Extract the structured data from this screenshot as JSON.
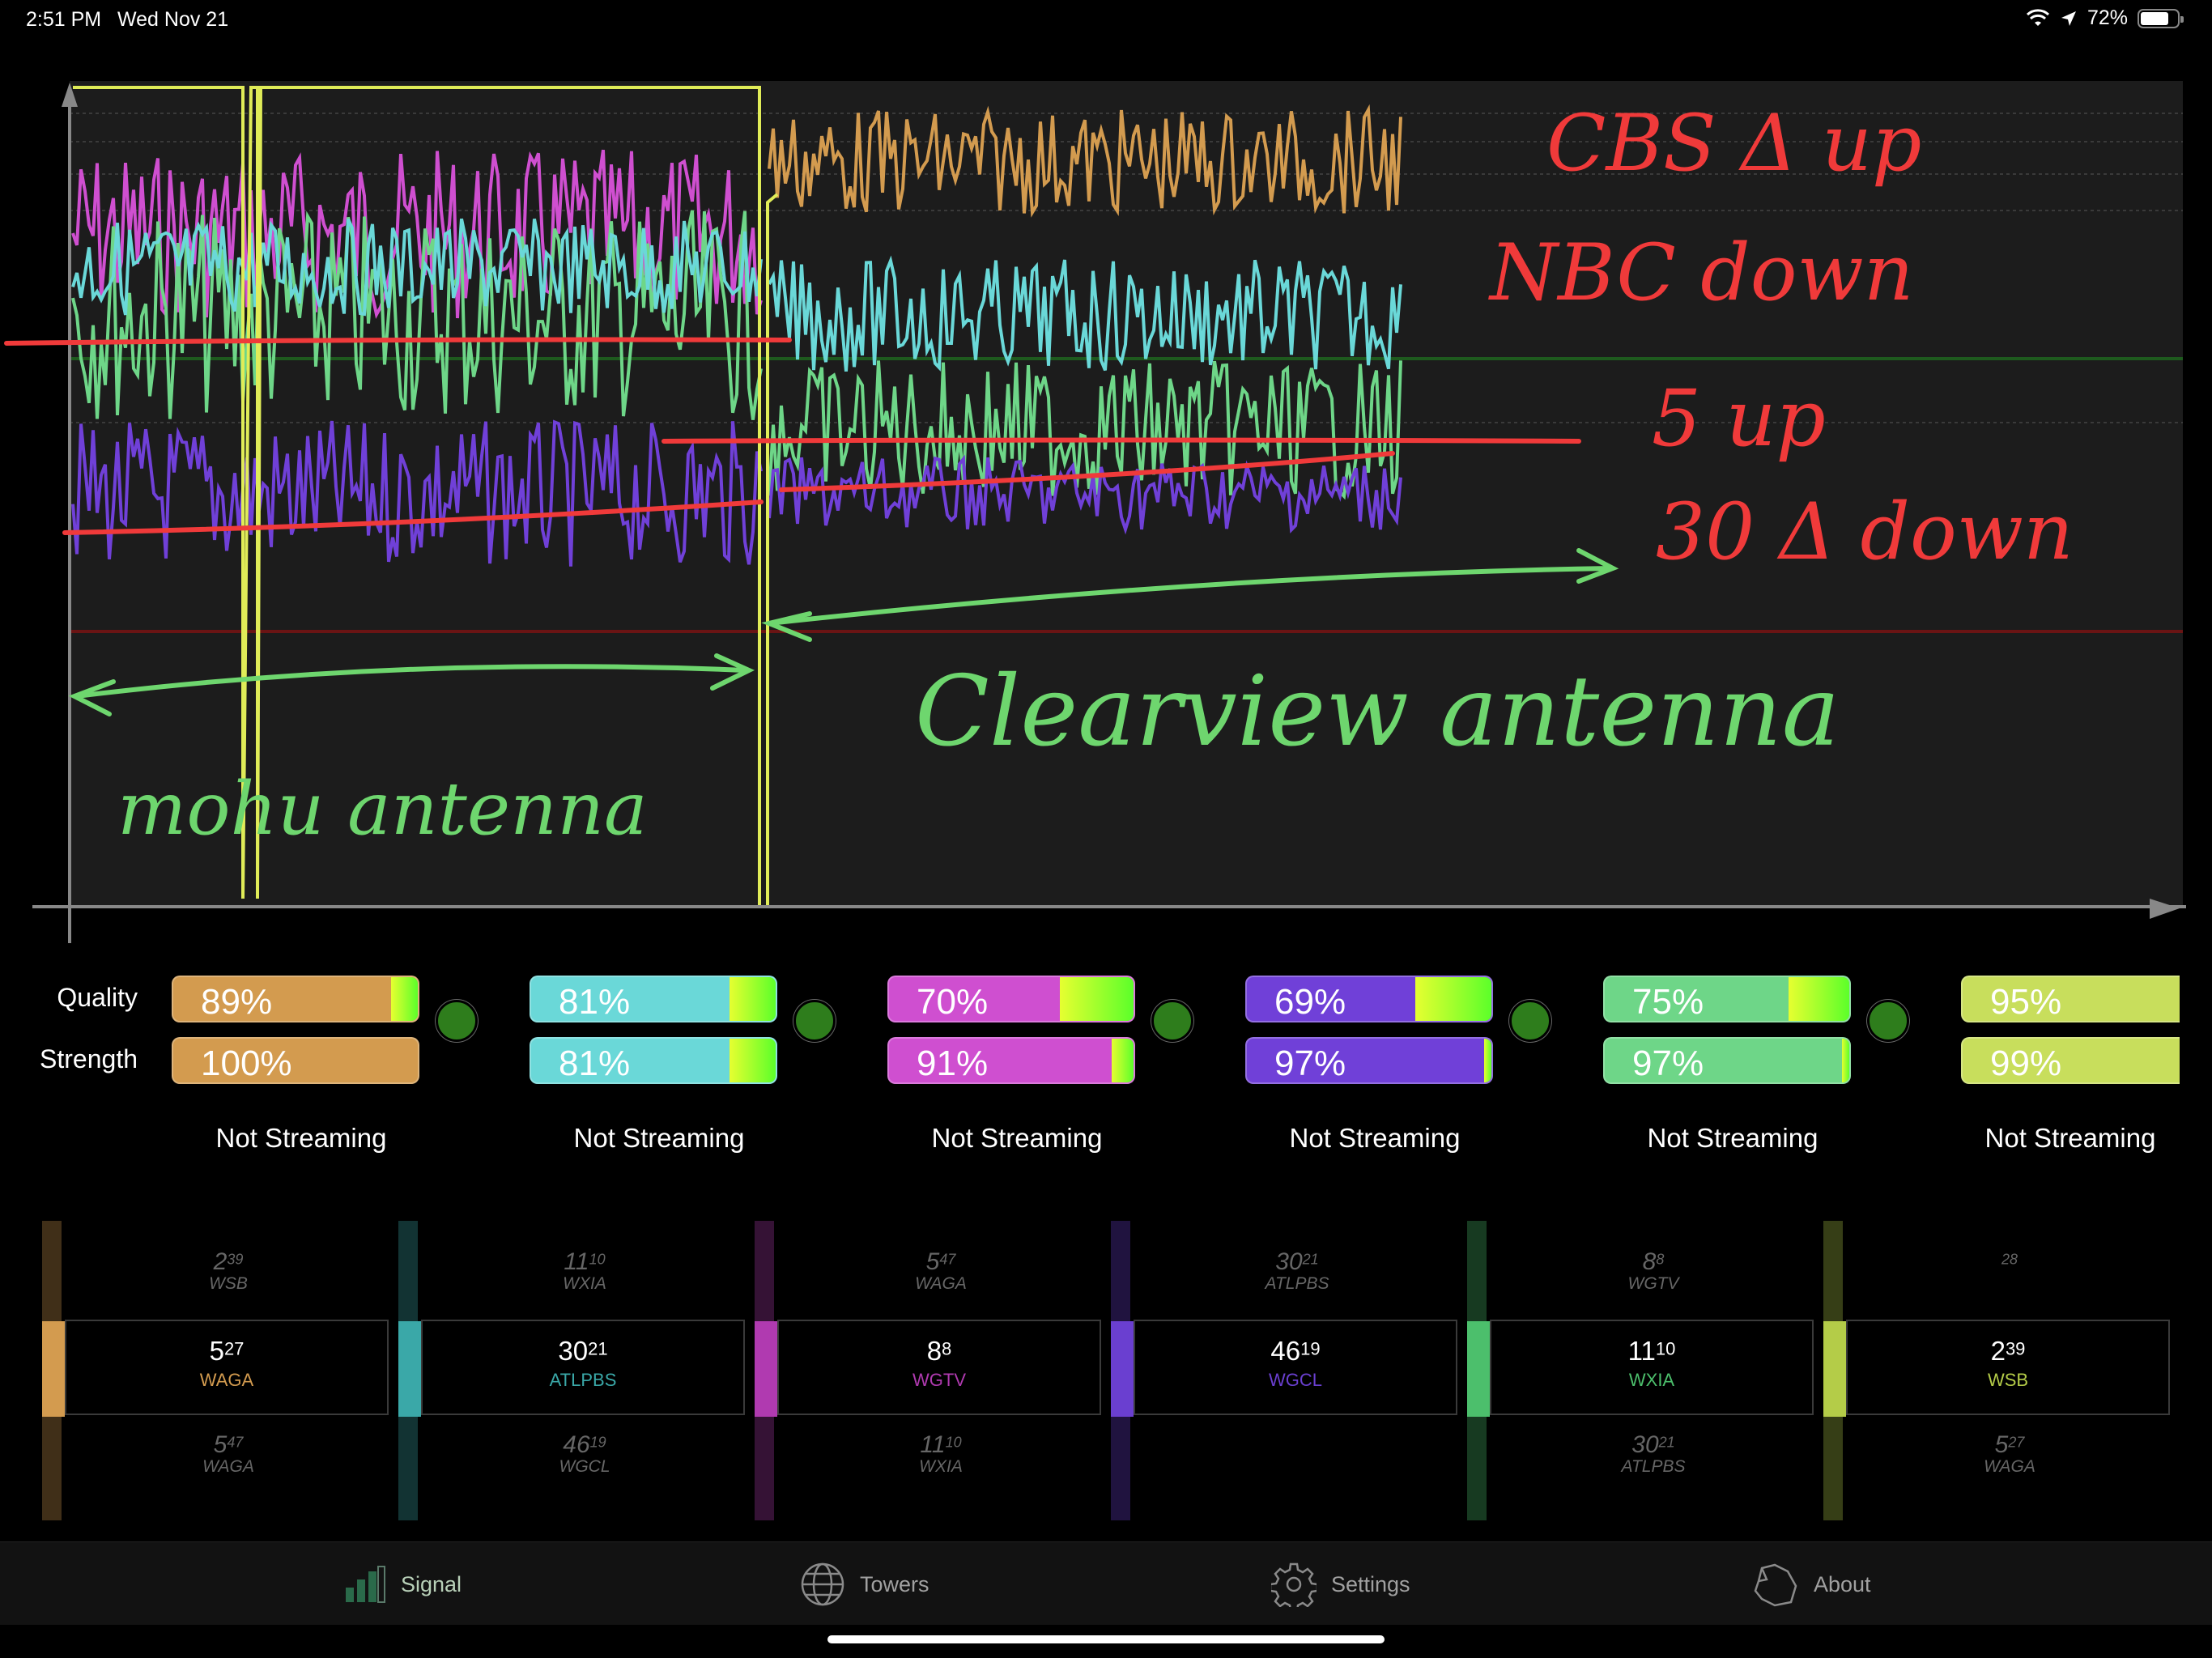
{
  "status_bar": {
    "time": "2:51 PM",
    "date": "Wed Nov 21",
    "battery": "72%"
  },
  "annotations": {
    "line1": "CBS Δ up",
    "line2": "NBC down",
    "line3": "5 up",
    "line4": "30 Δ down",
    "left_label": "mohu antenna",
    "right_label": "Clearview antenna"
  },
  "meter_labels": {
    "quality": "Quality",
    "strength": "Strength"
  },
  "stations": [
    {
      "color": "#d39b4f",
      "quality": "89%",
      "strength": "100%",
      "q_fill": 0.89,
      "s_fill": 1.0,
      "status": "Not Streaming"
    },
    {
      "color": "#6ad8d8",
      "quality": "81%",
      "strength": "81%",
      "q_fill": 0.81,
      "s_fill": 0.81,
      "status": "Not Streaming"
    },
    {
      "color": "#cf4fd0",
      "quality": "70%",
      "strength": "91%",
      "q_fill": 0.7,
      "s_fill": 0.91,
      "status": "Not Streaming"
    },
    {
      "color": "#7040d8",
      "quality": "69%",
      "strength": "97%",
      "q_fill": 0.69,
      "s_fill": 0.97,
      "status": "Not Streaming"
    },
    {
      "color": "#6ed688",
      "quality": "75%",
      "strength": "97%",
      "q_fill": 0.75,
      "s_fill": 0.97,
      "status": "Not Streaming"
    },
    {
      "color": "#c8de5c",
      "quality": "95%",
      "strength": "99%",
      "q_fill": 0.95,
      "s_fill": 0.99,
      "status": "Not Streaming"
    }
  ],
  "pickers": [
    {
      "color": "#d39b4f",
      "top": {
        "num": "2",
        "sub": "39",
        "call": "WSB"
      },
      "sel": {
        "num": "5",
        "sub": "27",
        "call": "WAGA"
      },
      "bot": {
        "num": "5",
        "sub": "47",
        "call": "WAGA"
      }
    },
    {
      "color": "#3aa8a8",
      "top": {
        "num": "11",
        "sub": "10",
        "call": "WXIA"
      },
      "sel": {
        "num": "30",
        "sub": "21",
        "call": "ATLPBS"
      },
      "bot": {
        "num": "46",
        "sub": "19",
        "call": "WGCL"
      }
    },
    {
      "color": "#b03ab0",
      "top": {
        "num": "5",
        "sub": "47",
        "call": "WAGA"
      },
      "sel": {
        "num": "8",
        "sub": "8",
        "call": "WGTV"
      },
      "bot": {
        "num": "11",
        "sub": "10",
        "call": "WXIA"
      }
    },
    {
      "color": "#6a3fd0",
      "top": {
        "num": "30",
        "sub": "21",
        "call": "ATLPBS"
      },
      "sel": {
        "num": "46",
        "sub": "19",
        "call": "WGCL"
      },
      "bot": {
        "num": "",
        "sub": "",
        "call": ""
      }
    },
    {
      "color": "#4cbf6c",
      "top": {
        "num": "8",
        "sub": "8",
        "call": "WGTV"
      },
      "sel": {
        "num": "11",
        "sub": "10",
        "call": "WXIA"
      },
      "bot": {
        "num": "30",
        "sub": "21",
        "call": "ATLPBS"
      }
    },
    {
      "color": "#b4cc48",
      "top": {
        "num": "",
        "sub": "28",
        "call": ""
      },
      "sel": {
        "num": "2",
        "sub": "39",
        "call": "WSB"
      },
      "bot": {
        "num": "5",
        "sub": "27",
        "call": "WAGA"
      }
    }
  ],
  "tabs": [
    {
      "label": "Signal",
      "icon": "signal-bars-icon",
      "active": true
    },
    {
      "label": "Towers",
      "icon": "globe-icon",
      "active": false
    },
    {
      "label": "Settings",
      "icon": "gear-icon",
      "active": false
    },
    {
      "label": "About",
      "icon": "about-icon",
      "active": false
    }
  ]
}
